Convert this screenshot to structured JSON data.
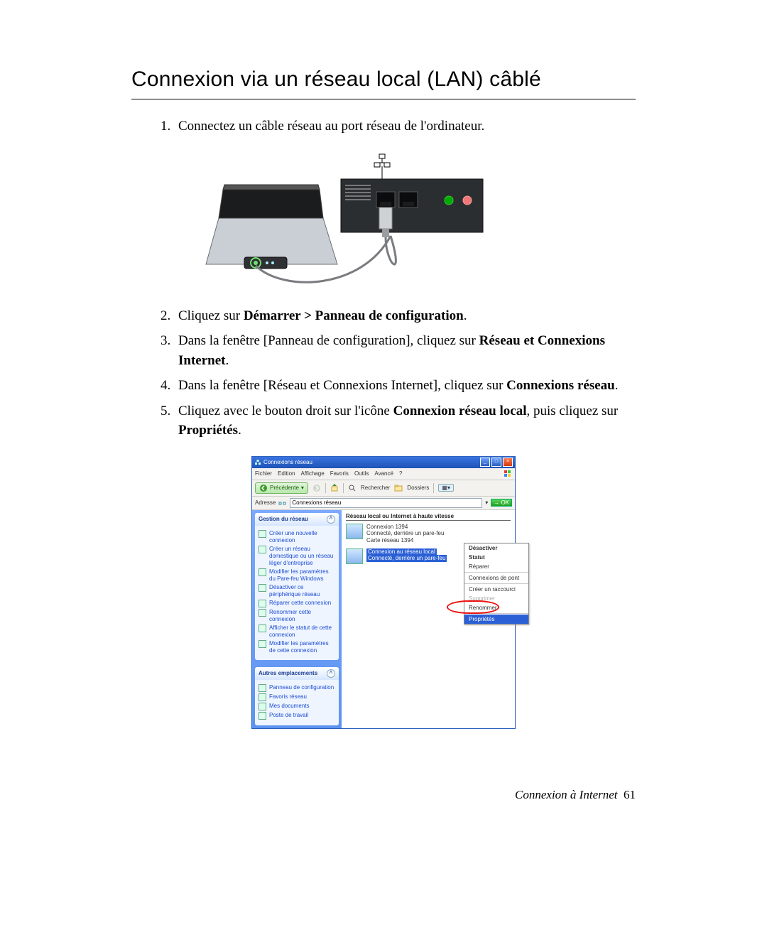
{
  "title": "Connexion via un réseau local (LAN) câblé",
  "steps": [
    {
      "n": "1",
      "pre": "Connectez un câble réseau au port réseau de l'ordinateur.",
      "bold": "",
      "post": ""
    },
    {
      "n": "2",
      "pre": "Cliquez sur ",
      "bold": "Démarrer > Panneau de configuration",
      "post": "."
    },
    {
      "n": "3",
      "pre": "Dans la fenêtre [Panneau de configuration], cliquez sur ",
      "bold": "Réseau et Connexions Internet",
      "post": "."
    },
    {
      "n": "4",
      "pre": "Dans la fenêtre [Réseau et Connexions Internet], cliquez sur ",
      "bold": "Connexions réseau",
      "post": "."
    },
    {
      "n": "5",
      "pre": "Cliquez avec le bouton droit sur l'icône ",
      "bold": "Connexion réseau local",
      "post": ", puis cliquez sur",
      "bold2": "Propriétés",
      "post2": "."
    }
  ],
  "screenshot": {
    "title": "Connexions réseau",
    "menu": [
      "Fichier",
      "Edition",
      "Affichage",
      "Favoris",
      "Outils",
      "Avancé",
      "?"
    ],
    "toolbar": {
      "back": "Précédente",
      "search": "Rechercher",
      "folders": "Dossiers"
    },
    "addressLabel": "Adresse",
    "addressValue": "Connexions réseau",
    "go": "OK",
    "sidebar": {
      "panel1": {
        "title": "Gestion du réseau",
        "items": [
          "Créer une nouvelle connexion",
          "Créer un réseau domestique ou un réseau léger d'entreprise",
          "Modifier les paramètres du Pare-feu Windows",
          "Désactiver ce périphérique réseau",
          "Réparer cette connexion",
          "Renommer cette connexion",
          "Afficher le statut de cette connexion",
          "Modifier les paramètres de cette connexion"
        ]
      },
      "panel2": {
        "title": "Autres emplacements",
        "items": [
          "Panneau de configuration",
          "Favoris réseau",
          "Mes documents",
          "Poste de travail"
        ]
      }
    },
    "main": {
      "group": "Réseau local ou Internet à haute vitesse",
      "conn1": {
        "name": "Connexion 1394",
        "status": "Connecté, derrière un pare-feu",
        "detail": "Carte réseau 1394"
      },
      "conn2": {
        "name": "Connexion au réseau local",
        "status": "Connecté, derrière un pare-feu"
      },
      "context": [
        "Désactiver",
        "Statut",
        "Réparer",
        "Connexions de pont",
        "Créer un raccourci",
        "Supprimer",
        "Renommer",
        "Propriétés"
      ]
    }
  },
  "footer": {
    "label": "Connexion à Internet",
    "page": "61"
  }
}
